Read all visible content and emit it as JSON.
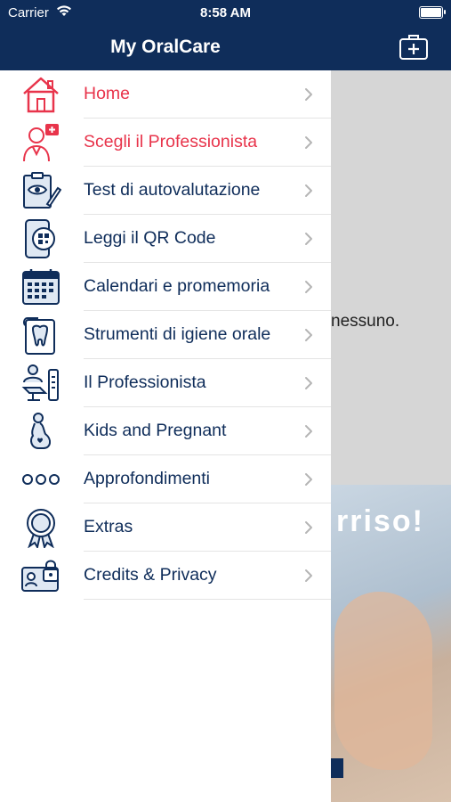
{
  "status_bar": {
    "carrier": "Carrier",
    "time": "8:58 AM"
  },
  "header": {
    "title": "My OralCare",
    "add_icon": "medical-kit-plus-icon"
  },
  "colors": {
    "primary": "#0f2d5a",
    "accent": "#e8344b"
  },
  "menu": [
    {
      "label": "Home",
      "icon": "house-icon",
      "active": true
    },
    {
      "label": "Scegli il Professionista",
      "icon": "doctor-icon",
      "active": true
    },
    {
      "label": "Test di autovalutazione",
      "icon": "clipboard-eye-icon",
      "active": false
    },
    {
      "label": "Leggi il QR Code",
      "icon": "qr-scan-icon",
      "active": false
    },
    {
      "label": "Calendari e promemoria",
      "icon": "calendar-icon",
      "active": false
    },
    {
      "label": "Strumenti di igiene orale",
      "icon": "tooth-icon",
      "active": false
    },
    {
      "label": "Il Professionista",
      "icon": "dental-chair-icon",
      "active": false
    },
    {
      "label": "Kids and Pregnant",
      "icon": "pregnant-icon",
      "active": false
    },
    {
      "label": "Approfondimenti",
      "icon": "dots-icon",
      "active": false
    },
    {
      "label": "Extras",
      "icon": "badge-icon",
      "active": false
    },
    {
      "label": "Credits & Privacy",
      "icon": "id-lock-icon",
      "active": false
    }
  ],
  "background": {
    "text": "nessuno.",
    "banner_text": "rriso!"
  }
}
